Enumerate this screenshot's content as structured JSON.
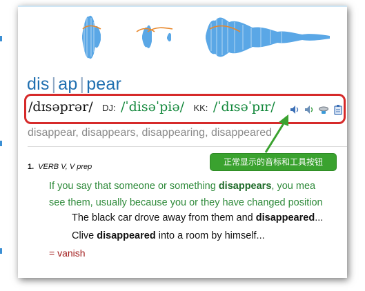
{
  "headword": {
    "parts": [
      "dis",
      "ap",
      "pear"
    ],
    "separator": "|"
  },
  "pronunciation": {
    "primary": "/dɪsəprər/",
    "dj_label": "DJ:",
    "dj": "/ˈdisəˈpiə/",
    "kk_label": "KK:",
    "kk": "/ˈdɪsəˈpɪr/"
  },
  "toolbar": {
    "icons": [
      "speaker-icon",
      "speaker-icon",
      "speech-recognition-icon",
      "copy-icon"
    ]
  },
  "forms": "disappear, disappears, disappearing, disappeared",
  "annotation": {
    "text": "正常显示的音标和工具按钮"
  },
  "sense": {
    "number": "1.",
    "grammar": "VERB V, V prep",
    "definition": {
      "part1": "If you say that someone or something ",
      "bold": "disappears",
      "part2": ", you mea",
      "line2": "see them, usually because you or they have changed position"
    },
    "examples": [
      {
        "pre": "The black car drove away from them and ",
        "bold": "disappeared",
        "post": "..."
      },
      {
        "pre": "Clive ",
        "bold": "disappeared",
        "post": " into a room by himself..."
      }
    ],
    "synonym": "= vanish"
  },
  "colors": {
    "headword": "#1f6fb0",
    "highlight_border": "#d62a2a",
    "phonetic_green": "#11873a",
    "definition": "#2e8a3a",
    "callout": "#3aa22f",
    "synonym": "#a11b1b"
  }
}
